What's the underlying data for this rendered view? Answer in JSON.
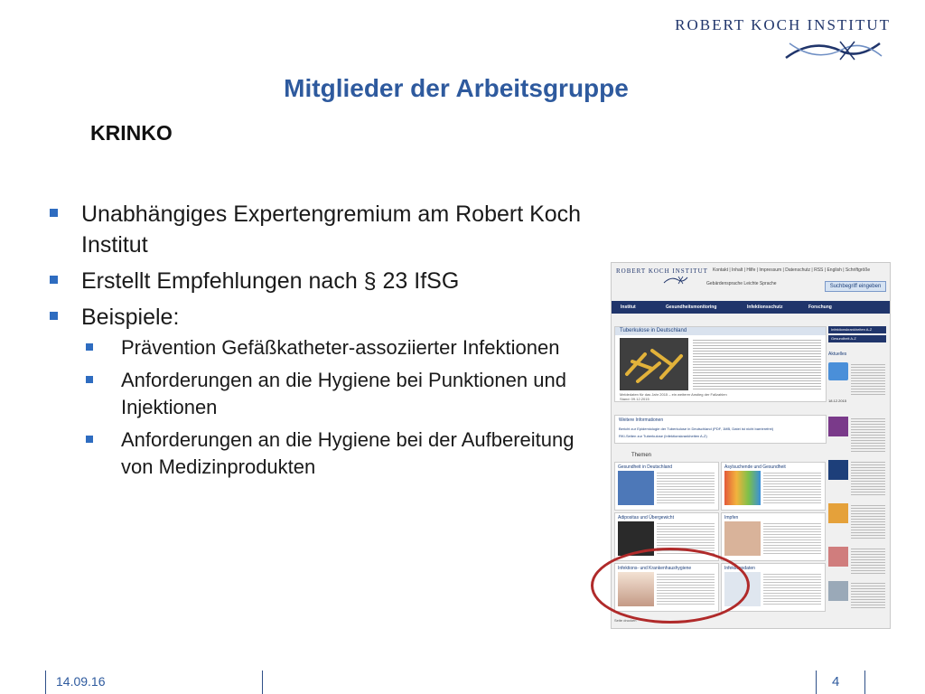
{
  "header": {
    "brand": "ROBERT KOCH INSTITUT",
    "title": "Mitglieder der Arbeitsgruppe",
    "subtitle": "KRINKO"
  },
  "bullets": [
    "Unabhängiges Expertengremium am Robert Koch Institut",
    "Erstellt Empfehlungen nach § 23 IfSG",
    "Beispiele:"
  ],
  "sub_bullets": [
    "Prävention Gefäßkatheter-assoziierter Infektionen",
    "Anforderungen an die Hygiene bei Punktionen und Injektionen",
    "Anforderungen an die Hygiene bei der Aufbereitung von Medizinprodukten"
  ],
  "footer": {
    "date": "14.09.16",
    "page": "4"
  },
  "website": {
    "brand": "ROBERT KOCH INSTITUT",
    "top_links": "Kontakt | Inhalt | Hilfe | Impressum | Datenschutz | RSS | English | Schriftgröße",
    "accessibility": "Gebärdensprache   Leichte Sprache",
    "search_placeholder": "Suchbegriff eingeben",
    "nav": [
      "Institut",
      "Gesundheitsmonitoring",
      "Infektionsschutz",
      "Forschung"
    ],
    "main_title": "Tuberkulose in Deutschland",
    "main_footer": "Meldedaten für das Jahr 2015 – ein weiterer Anstieg der Fallzahlen",
    "main_date": "Stand: 09.12.2015",
    "weitere_title": "Weitere Informationen",
    "weitere_links": [
      "Bericht zur Epidemiologie der Tuberkulose in Deutschland (PDF, 1MB, Datei ist nicht barrierefrei)",
      "RKI-Seiten zur Tuberkulose (Infektionskrankheiten A-Z)"
    ],
    "themen_label": "Themen",
    "tiles": [
      "Gesundheit in Deutschland",
      "Asylsuchende und Gesundheit",
      "Adipositas und Übergewicht",
      "Impfen",
      "Infektions- und Krankenhaushygiene",
      "Infektionsdaten"
    ],
    "sidebar": {
      "az": "Infektionskrankheiten A-Z",
      "gesundheit": "Gesundheit A-Z",
      "aktuelles": "Aktuelles",
      "tweet_date": "18.12.2015"
    },
    "print_label": "Seite drucken"
  },
  "colors": {
    "title_blue": "#2e5a9e",
    "bullet_blue": "#2e6cc0",
    "rki_navy": "#20356b",
    "highlight_red": "#b02a2a"
  }
}
